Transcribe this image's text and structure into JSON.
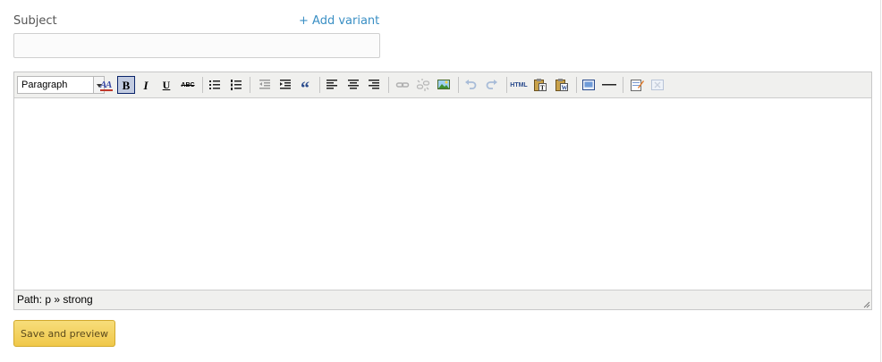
{
  "form": {
    "subject_label": "Subject",
    "add_variant_label": "+ Add variant",
    "subject_value": "",
    "subject_placeholder": ""
  },
  "editor": {
    "format_select": {
      "selected": "Paragraph"
    },
    "glyphs": {
      "bold": "B",
      "italic": "I",
      "underline": "U",
      "strikethrough": "ABC",
      "blockquote": "“",
      "html": "HTML"
    },
    "toolbar_icons": [
      "font-color-icon",
      "bold-icon",
      "italic-icon",
      "underline-icon",
      "strikethrough-icon",
      "bullet-list-icon",
      "numbered-list-icon",
      "outdent-icon",
      "indent-icon",
      "blockquote-icon",
      "align-left-icon",
      "align-center-icon",
      "align-right-icon",
      "link-icon",
      "unlink-icon",
      "image-icon",
      "undo-icon",
      "redo-icon",
      "html-source-icon",
      "paste-text-icon",
      "paste-word-icon",
      "media-icon",
      "horizontal-rule-icon",
      "edit-attributes-icon",
      "remove-format-icon"
    ],
    "active_tool": "bold",
    "content": "",
    "status_path": "Path: p » strong"
  },
  "actions": {
    "save_preview_label": "Save and preview"
  },
  "colors": {
    "link": "#3a8fc4",
    "button_bg": "#f0c84a",
    "toolbar_bg": "#f0f0ee",
    "active_tool_bg": "#c2cbe0"
  }
}
